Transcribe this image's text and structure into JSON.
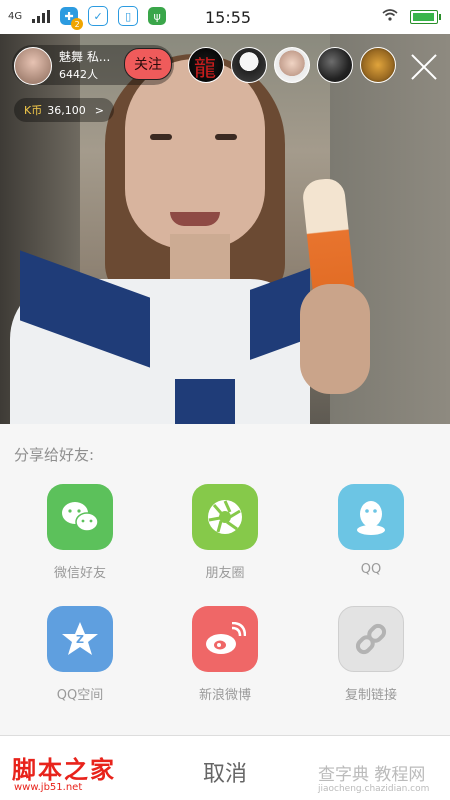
{
  "status_bar": {
    "network": "4G",
    "time": "15:55",
    "badge": "2"
  },
  "live": {
    "host_name": "魅舞 私...",
    "host_viewers": "6442人",
    "follow_label": "关注",
    "kcoin_label": "K币",
    "kcoin_value": "36,100",
    "kcoin_arrow": ">",
    "viewer_avatars": [
      "dragon-avatar",
      "penguin-avatar",
      "girl-avatar",
      "dark-avatar",
      "animal-avatar"
    ]
  },
  "share": {
    "title": "分享给好友:",
    "options": [
      {
        "label": "微信好友",
        "icon": "wechat-icon",
        "color": "#5cc15b"
      },
      {
        "label": "朋友圈",
        "icon": "moments-icon",
        "color": "#86c94a"
      },
      {
        "label": "QQ",
        "icon": "qq-icon",
        "color": "#6cc5e4"
      },
      {
        "label": "QQ空间",
        "icon": "qzone-icon",
        "color": "#5f9fdf"
      },
      {
        "label": "新浪微博",
        "icon": "weibo-icon",
        "color": "#ef6767"
      },
      {
        "label": "复制链接",
        "icon": "link-icon",
        "color": "#e3e3e3"
      }
    ],
    "cancel_label": "取消"
  },
  "watermarks": {
    "left": "脚本之家",
    "left_sub": "www.jb51.net",
    "right": "查字典 教程网",
    "right_sub": "jiaocheng.chazidian.com"
  }
}
